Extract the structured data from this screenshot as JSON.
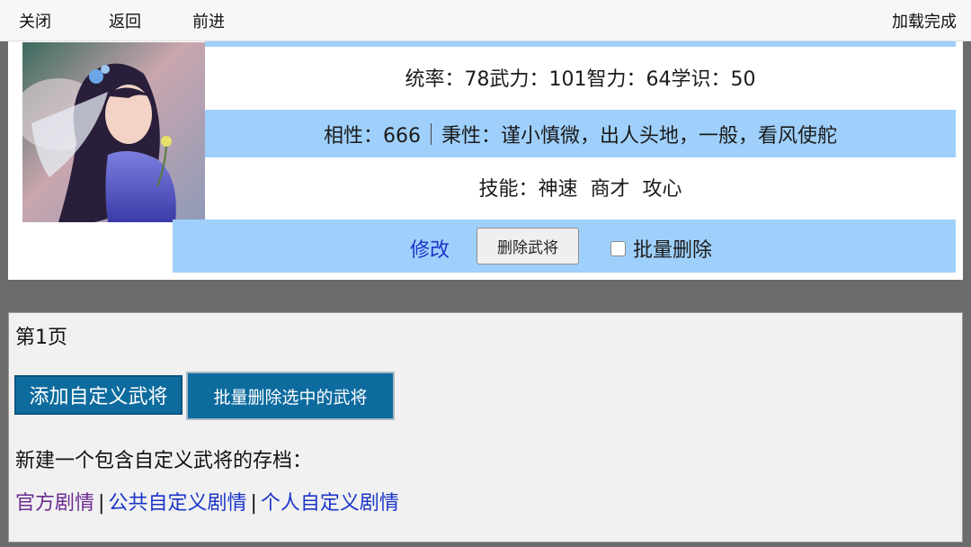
{
  "topbar": {
    "close_label": "关闭",
    "back_label": "返回",
    "forward_label": "前进",
    "status_label": "加载完成"
  },
  "character": {
    "stats_line": "统率：78武力：101智力：64学识：50",
    "affinity": "相性：666",
    "temperament": "秉性：谨小慎微，出人头地，一般，看风使舵",
    "skills_prefix": "技能：",
    "skills": [
      "神速",
      "商才",
      "攻心"
    ]
  },
  "actions": {
    "edit_label": "修改",
    "delete_label": "删除武将",
    "batch_delete_label": "批量删除"
  },
  "panel": {
    "page_label": "第1页",
    "add_button_label": "添加自定义武将",
    "batch_delete_button_label": "批量删除选中的武将",
    "save_prompt": "新建一个包含自定义武将的存档：",
    "links": {
      "official": "官方剧情",
      "public": "公共自定义剧情",
      "personal": "个人自定义剧情",
      "separator": "|"
    }
  },
  "colors": {
    "row_highlight": "#9fd0fb",
    "button_blue": "#0d6b9e",
    "link_blue": "#1b35c9",
    "visited_purple": "#6b2b8f"
  },
  "icons": {
    "portrait": "character-portrait-image",
    "checkbox": "checkbox-unchecked"
  }
}
